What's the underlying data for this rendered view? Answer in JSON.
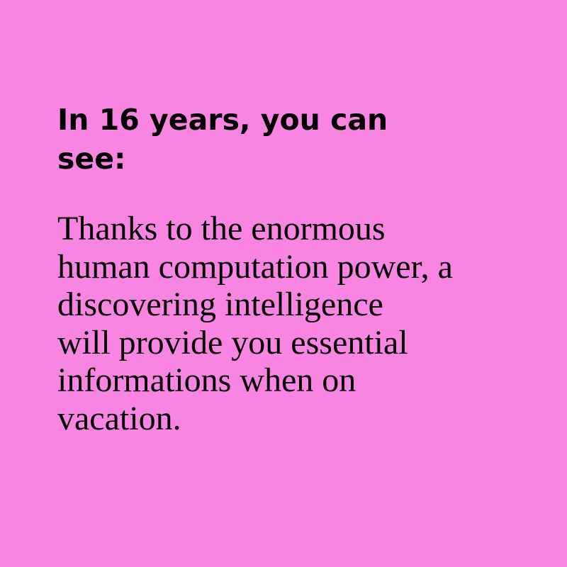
{
  "colors": {
    "background": "#f985e3",
    "text": "#000000"
  },
  "heading": {
    "lines": [
      "In 16 years, you can",
      "see:"
    ]
  },
  "body": {
    "lines": [
      "Thanks to the enormous",
      "human computation power, a",
      "discovering intelligence",
      "will provide you essential",
      "informations when on",
      "vacation."
    ]
  }
}
